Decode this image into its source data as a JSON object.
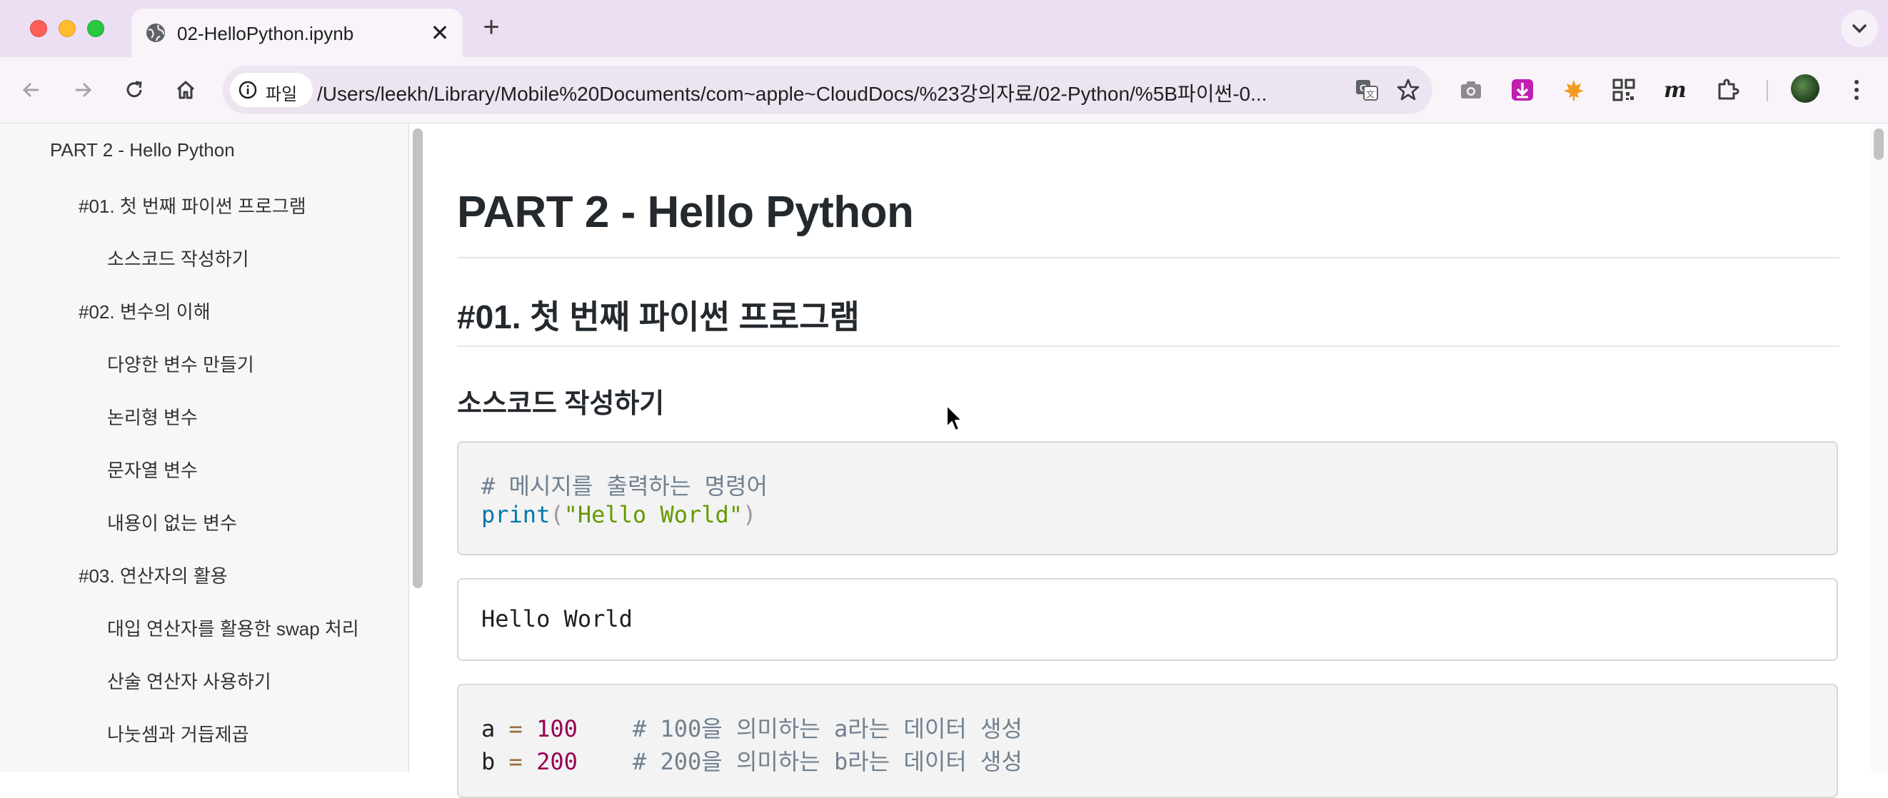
{
  "tab": {
    "title": "02-HelloPython.ipynb",
    "close_label": "✕",
    "new_tab_label": "+"
  },
  "omnibox": {
    "chip_label": "파일",
    "url": "/Users/leekh/Library/Mobile%20Documents/com~apple~CloudDocs/%23강의자료/02-Python/%5B파이썬-0..."
  },
  "toolbar_icons": [
    "back-icon",
    "forward-icon",
    "reload-icon",
    "home-icon",
    "translate-icon",
    "star-icon",
    "camera-icon",
    "download-icon",
    "maple-icon",
    "qr-icon",
    "m-icon",
    "extensions-icon",
    "avatar",
    "menu-icon"
  ],
  "sidebar": {
    "items": [
      {
        "label": "PART 2 - Hello Python",
        "level": 1
      },
      {
        "label": "#01. 첫 번째 파이썬 프로그램",
        "level": 2
      },
      {
        "label": "소스코드 작성하기",
        "level": 3
      },
      {
        "label": "#02. 변수의 이해",
        "level": 2
      },
      {
        "label": "다양한 변수 만들기",
        "level": 3
      },
      {
        "label": "논리형 변수",
        "level": 3
      },
      {
        "label": "문자열 변수",
        "level": 3
      },
      {
        "label": "내용이 없는 변수",
        "level": 3
      },
      {
        "label": "#03. 연산자의 활용",
        "level": 2
      },
      {
        "label": "대입 연산자를 활용한 swap 처리",
        "level": 3
      },
      {
        "label": "산술 연산자 사용하기",
        "level": 3
      },
      {
        "label": "나눗셈과 거듭제곱",
        "level": 3
      }
    ]
  },
  "document": {
    "h1": "PART 2 - Hello Python",
    "h2": "#01. 첫 번째 파이썬 프로그램",
    "h3": "소스코드 작성하기",
    "cell1": {
      "comment": "# 메시지를 출력하는 명령어",
      "func": "print",
      "open_paren": "(",
      "string": "\"Hello World\"",
      "close_paren": ")"
    },
    "output1": "Hello World",
    "cell2": {
      "line1_var": "a",
      "line1_op": "=",
      "line1_num": "100",
      "line1_comment": "# 100을 의미하는 a라는 데이터 생성",
      "line2_var": "b",
      "line2_op": "=",
      "line2_num": "200",
      "line2_comment": "# 200을 의미하는 b라는 데이터 생성"
    }
  }
}
